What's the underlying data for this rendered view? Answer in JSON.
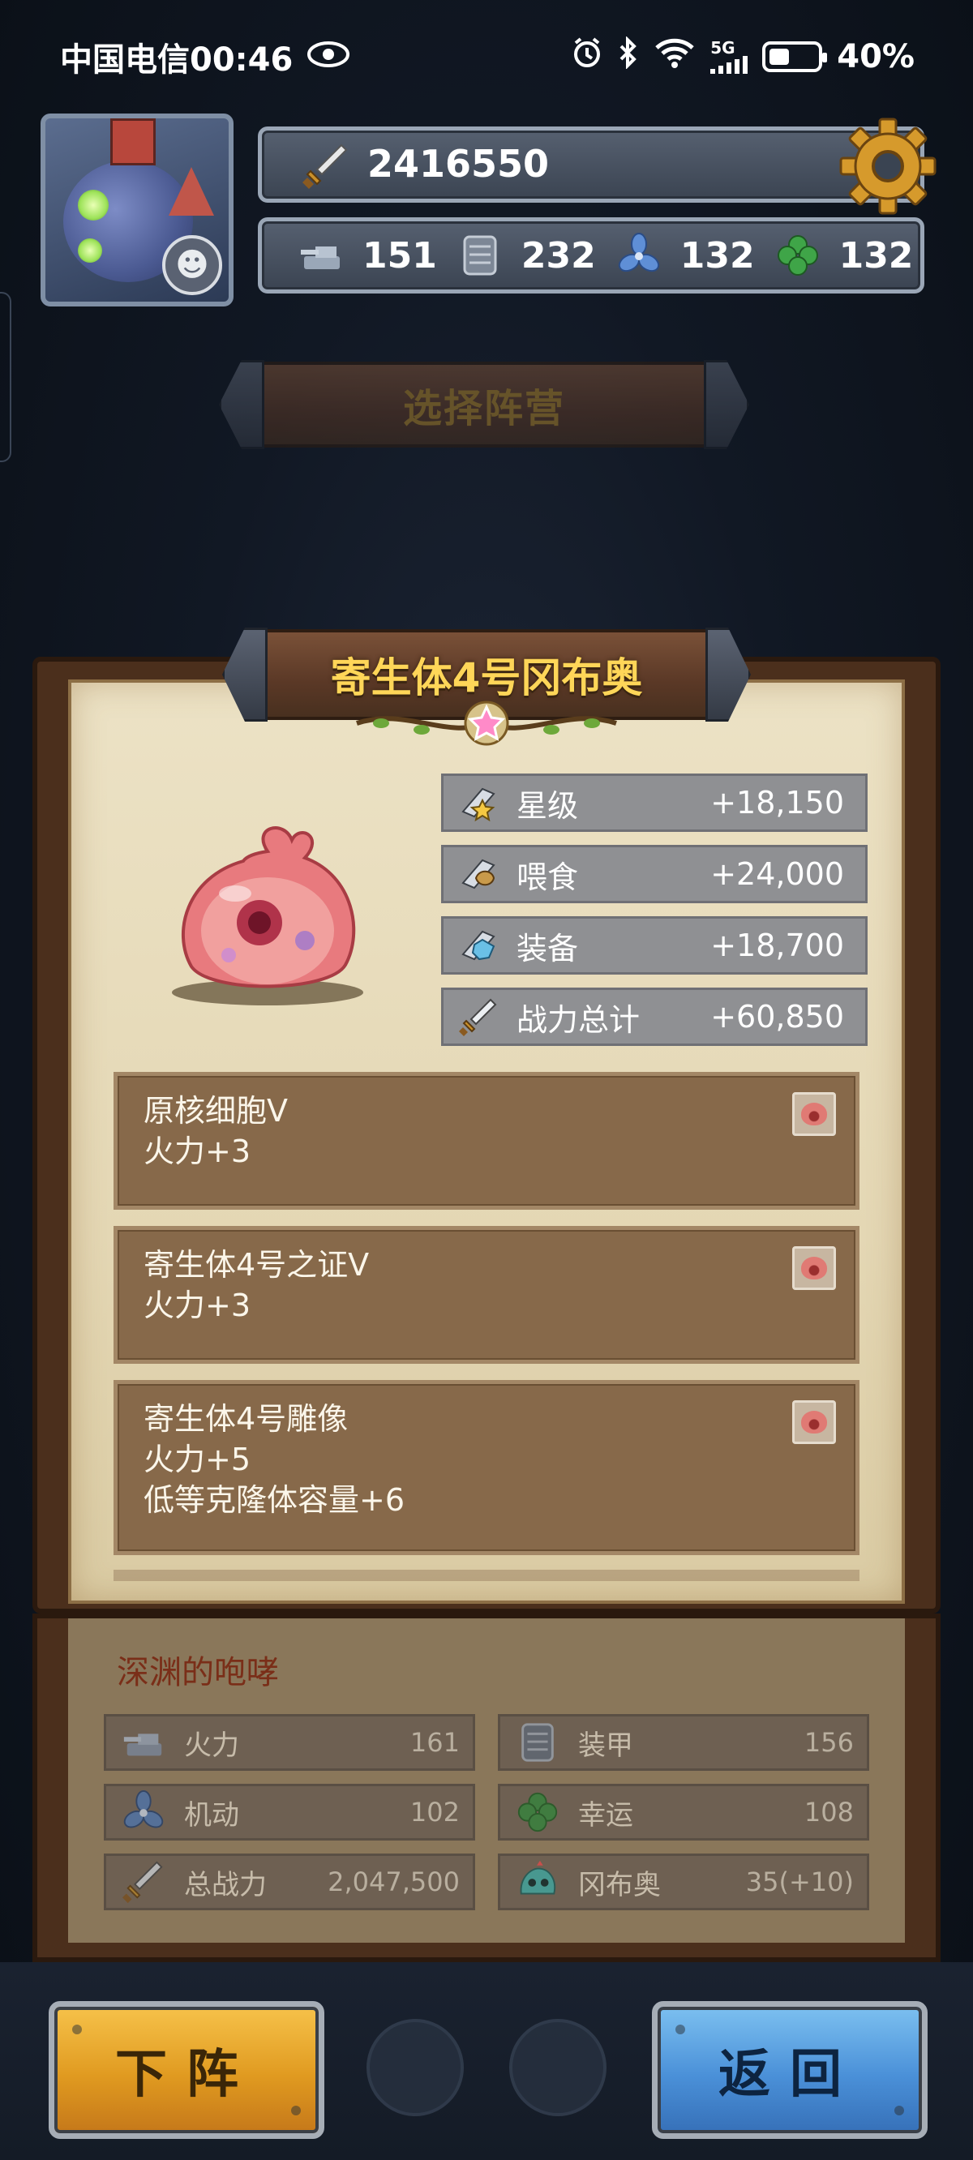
{
  "status_bar": {
    "carrier_time": "中国电信00:46",
    "network": "5G",
    "battery": "40%"
  },
  "header": {
    "combat_power": "2416550",
    "resources": [
      {
        "icon": "cannon-icon",
        "value": "151"
      },
      {
        "icon": "armor-plate-icon",
        "value": "232"
      },
      {
        "icon": "propeller-icon",
        "value": "132"
      },
      {
        "icon": "clover-icon",
        "value": "132"
      }
    ]
  },
  "faction_button": "选择阵营",
  "hero": {
    "name": "寄生体4号冈布奥",
    "star_level": 1,
    "stats": [
      {
        "icon": "star-wing-icon",
        "label": "星级",
        "value": "+18,150"
      },
      {
        "icon": "feed-wing-icon",
        "label": "喂食",
        "value": "+24,000"
      },
      {
        "icon": "equip-wing-icon",
        "label": "装备",
        "value": "+18,700"
      },
      {
        "icon": "sword-icon",
        "label": "战力总计",
        "value": "+60,850"
      }
    ],
    "skills": [
      {
        "title": "原核细胞Ⅴ",
        "lines": [
          "火力+3"
        ]
      },
      {
        "title": "寄生体4号之证Ⅴ",
        "lines": [
          "火力+3"
        ]
      },
      {
        "title": "寄生体4号雕像",
        "lines": [
          "火力+5",
          "低等克隆体容量+6"
        ]
      }
    ]
  },
  "team": {
    "title": "深渊的咆哮",
    "attributes": [
      {
        "icon": "cannon-icon",
        "label": "火力",
        "value": "161"
      },
      {
        "icon": "armor-plate-icon",
        "label": "装甲",
        "value": "156"
      },
      {
        "icon": "propeller-icon",
        "label": "机动",
        "value": "102"
      },
      {
        "icon": "clover-icon",
        "label": "幸运",
        "value": "108"
      },
      {
        "icon": "sword-icon",
        "label": "总战力",
        "value": "2,047,500"
      },
      {
        "icon": "gumball-icon",
        "label": "冈布奥",
        "value": "35(+10)"
      }
    ]
  },
  "buttons": {
    "dismiss": "下阵",
    "back": "返回"
  },
  "colors": {
    "gold_text": "#ffd658",
    "stat_row": "#8f9093",
    "skill_box": "#87694a",
    "button_yellow": "#e09a20",
    "button_blue": "#4a90d8"
  }
}
